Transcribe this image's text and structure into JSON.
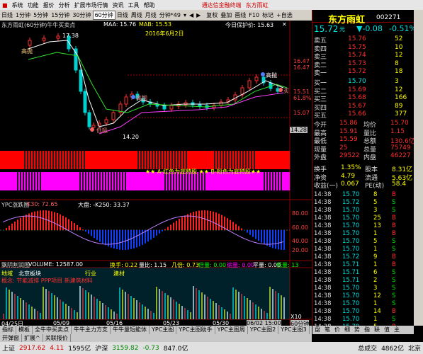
{
  "menu": [
    "系统",
    "功能",
    "报价",
    "分析",
    "扩展市场行情",
    "资讯",
    "工具",
    "帮助"
  ],
  "menu_center": "通达信金融终端",
  "menu_stock": "东方雨虹",
  "toolbar": {
    "items": [
      "日线",
      "1分钟",
      "5分钟",
      "15分钟",
      "30分钟",
      "60分钟",
      "日线",
      "周线",
      "月线",
      "分钟*49"
    ],
    "selected": "60分钟",
    "right": [
      "复权",
      "叠加",
      "画线",
      "F10",
      "标记",
      "+自选"
    ]
  },
  "chart": {
    "title": "东方雨虹(60分钟)牛牛买卖点",
    "ma": "MA4: 15.76",
    "ma_val2": "MA8: 15.63",
    "maa": "MAA: 15.76",
    "mab": "MAB: 15.53",
    "guard": "今日保护价: 15.63",
    "date": "2016年6月2日",
    "high_label": "17.38",
    "low_label": "14.20",
    "labels": [
      "高抛",
      "低吸",
      "高抛",
      "高抛",
      "买"
    ],
    "right_scale": [
      "16.47",
      "16.47",
      "15.51",
      "15.51",
      "15.07"
    ],
    "right_pct": [
      "80.6%",
      "61.8%"
    ],
    "price_tag": "14.28",
    "band_text": "★★ A-红色为底特股  ★★ B-粉色为底特股★★",
    "indicator_title": "YPC涨跌图",
    "indicator_vals": "K30: 72.65",
    "market": "大盘: -K250: 33.37",
    "ind_scale": [
      "100.00",
      "80.00",
      "60.00",
      "40.00",
      "20.00"
    ],
    "vol_title": "飘阴割润图",
    "vol": "VOLUME: 12587.00",
    "vol2": "换手: 0.22",
    "vol_ratio": "量比: 1.15",
    "vol3": "几倍: 0.73",
    "vol4": "倍量: 0.00",
    "vol5": "缩量: 0.00",
    "vol6": "平量: 0.00",
    "vol7": "低量: 13",
    "region": "地域",
    "region_val": "北京板块",
    "industry": "行业",
    "industry_val": "建材",
    "region_line": "概念: 节能减排 PPP项目 新建筑材料",
    "vol_scale": [
      "X10"
    ],
    "x_dates": [
      "04/25日",
      "05/09",
      "05/16",
      "05/23",
      "05/30",
      "06/02 15:00"
    ],
    "x_label_right": "60分钟"
  },
  "tabs": [
    "指标",
    "模板",
    "全牛中买卖点",
    "牛牛主力方支",
    "牛牛量短能体",
    "YPC主图",
    "YPC主图助手",
    "YPC主图周",
    "YPC主图2",
    "YPC主图3"
  ],
  "tabs2": [
    "开弹窗",
    "扩展^",
    "关联报价"
  ],
  "quote": {
    "name": "东方雨虹",
    "code": "002271",
    "price": "15.72",
    "unit": "元",
    "change": "▼-0.08",
    "pct": "-0.51%",
    "sells": [
      [
        "卖五",
        "15.76",
        "52"
      ],
      [
        "卖四",
        "15.75",
        "10"
      ],
      [
        "卖三",
        "15.74",
        "12"
      ],
      [
        "卖二",
        "15.73",
        "8"
      ],
      [
        "卖一",
        "15.72",
        "18"
      ]
    ],
    "buys": [
      [
        "买一",
        "15.70",
        "3"
      ],
      [
        "买二",
        "15.69",
        "12"
      ],
      [
        "买三",
        "15.68",
        "166"
      ],
      [
        "买四",
        "15.67",
        "89"
      ],
      [
        "买五",
        "15.66",
        "377"
      ]
    ],
    "stats": [
      [
        "今开",
        "15.86",
        "均价",
        "15.70"
      ],
      [
        "最高",
        "15.91",
        "量比",
        "1.15"
      ],
      [
        "最低",
        "15.59",
        "总额",
        "130.6亿"
      ],
      [
        "现量",
        "25",
        "总量",
        "75749"
      ],
      [
        "外盘",
        "29522",
        "内盘",
        "46227"
      ]
    ],
    "stats2": [
      [
        "换手",
        "1.35%",
        "股本",
        "8.31亿"
      ],
      [
        "净资",
        "4.79",
        "流通",
        "5.63亿"
      ],
      [
        "收益(一)",
        "0.067",
        "PE(动)",
        "58.4"
      ]
    ],
    "ticks": [
      [
        "14:38",
        "15.70",
        "8",
        "B"
      ],
      [
        "14:38",
        "15.72",
        "5",
        "S"
      ],
      [
        "14:38",
        "15.70",
        "3",
        "S"
      ],
      [
        "14:38",
        "15.70",
        "25",
        "B"
      ],
      [
        "14:38",
        "15.70",
        "13",
        "B"
      ],
      [
        "14:38",
        "15.70",
        "1",
        "B"
      ],
      [
        "14:38",
        "15.70",
        "5",
        "S"
      ],
      [
        "14:38",
        "15.70",
        "1",
        "S"
      ],
      [
        "14:38",
        "15.72",
        "9",
        "B"
      ],
      [
        "14:38",
        "15.71",
        "1",
        "B"
      ],
      [
        "14:38",
        "15.71",
        "6",
        "S"
      ],
      [
        "14:38",
        "15.71",
        "2",
        "S"
      ],
      [
        "14:38",
        "15.70",
        "3",
        "S"
      ],
      [
        "14:38",
        "15.70",
        "12",
        "S"
      ],
      [
        "14:38",
        "15.70",
        "1",
        "S"
      ],
      [
        "14:38",
        "15.70",
        "14",
        "B"
      ],
      [
        "14:38",
        "15.70",
        "1",
        "S"
      ],
      [
        "14:38",
        "15.70",
        "5",
        "B"
      ]
    ],
    "bottom_tabs": [
      "盘",
      "笔",
      "价",
      "细",
      "势",
      "指",
      "联",
      "值",
      "主"
    ]
  },
  "status": {
    "sh": "上证",
    "sh_val": "2917.62",
    "sh_chg": "4.11",
    "sh_amt": "1595亿",
    "sz": "沪深",
    "sz_val": "3159.82",
    "sz_chg": "-0.73",
    "sz_amt": "847.0亿",
    "right1": "总成交",
    "right_val": "4862亿",
    "right2": "北京"
  },
  "colors": {
    "up": "#ff3030",
    "down": "#00d0d0",
    "accent": "#ffff00"
  }
}
